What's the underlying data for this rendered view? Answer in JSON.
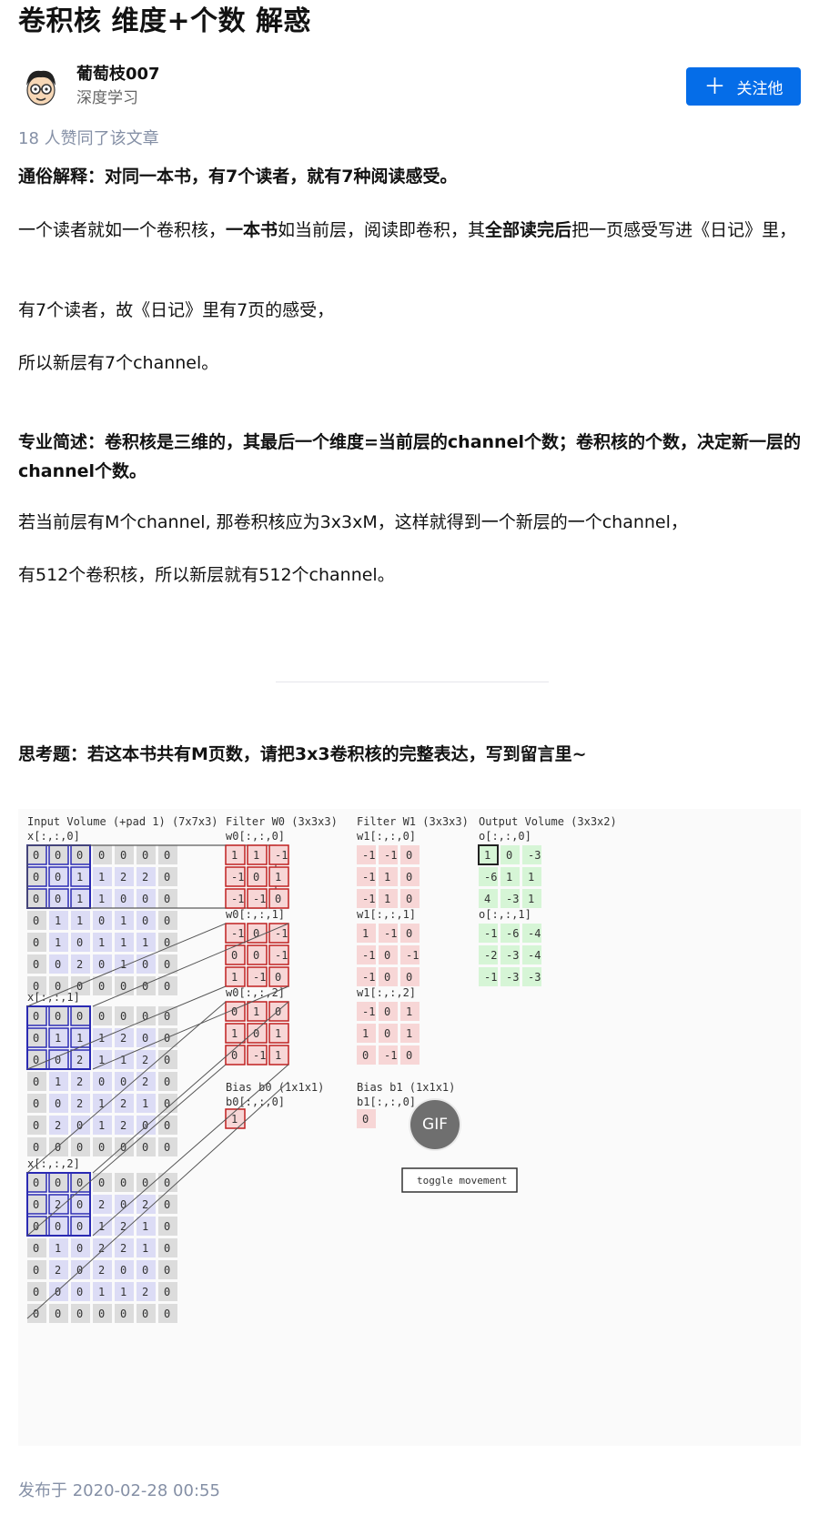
{
  "article": {
    "title": "卷积核 维度+个数 解惑",
    "author": {
      "name": "葡萄枝007",
      "headline": "深度学习",
      "follow_label": "关注他"
    },
    "votes_text": "18 人赞同了该文章",
    "para1": "通俗解释：对同一本书，有7个读者，就有7种阅读感受。",
    "para2": {
      "t1": "一个读者就如一个卷积核，",
      "b1": "一本书",
      "t2": "如当前层，阅读即卷积，其",
      "b2": "全部读完后",
      "t3": "把一页感受写进《日记》里，"
    },
    "para3": "有7个读者，故《日记》里有7页的感受，",
    "para4": "所以新层有7个channel。",
    "para5": "专业简述：卷积核是三维的，其最后一个维度=当前层的channel个数；卷积核的个数，决定新一层的channel个数。",
    "para6": "若当前层有M个channel, 那卷积核应为3x3xM，这样就得到一个新层的一个channel，",
    "para7": "有512个卷积核，所以新层就有512个channel。",
    "question": "思考题：若这本书共有M页数，请把3x3卷积核的完整表达，写到留言里~",
    "gif_badge": "GIF",
    "posted": "发布于 2020-02-28 00:55"
  },
  "figure": {
    "input_title": "Input Volume (+pad 1) (7x7x3)",
    "filter0_title": "Filter W0 (3x3x3)",
    "filter1_title": "Filter W1 (3x3x3)",
    "output_title": "Output Volume (3x3x2)",
    "x_labels": [
      "x[:,:,0]",
      "x[:,:,1]",
      "x[:,:,2]"
    ],
    "w0_labels": [
      "w0[:,:,0]",
      "w0[:,:,1]",
      "w0[:,:,2]"
    ],
    "w1_labels": [
      "w1[:,:,0]",
      "w1[:,:,1]",
      "w1[:,:,2]"
    ],
    "o_labels": [
      "o[:,:,0]",
      "o[:,:,1]"
    ],
    "bias0_title": "Bias b0 (1x1x1)",
    "bias0_label": "b0[:,:,0]",
    "bias1_title": "Bias b1 (1x1x1)",
    "bias1_label": "b1[:,:,0]",
    "toggle_label": "toggle movement",
    "x": [
      [
        [
          "0",
          "0",
          "0",
          "0",
          "0",
          "0",
          "0"
        ],
        [
          "0",
          "0",
          "1",
          "1",
          "2",
          "2",
          "0"
        ],
        [
          "0",
          "0",
          "1",
          "1",
          "0",
          "0",
          "0"
        ],
        [
          "0",
          "1",
          "1",
          "0",
          "1",
          "0",
          "0"
        ],
        [
          "0",
          "1",
          "0",
          "1",
          "1",
          "1",
          "0"
        ],
        [
          "0",
          "0",
          "2",
          "0",
          "1",
          "0",
          "0"
        ],
        [
          "0",
          "0",
          "0",
          "0",
          "0",
          "0",
          "0"
        ]
      ],
      [
        [
          "0",
          "0",
          "0",
          "0",
          "0",
          "0",
          "0"
        ],
        [
          "0",
          "1",
          "1",
          "1",
          "2",
          "0",
          "0"
        ],
        [
          "0",
          "0",
          "2",
          "1",
          "1",
          "2",
          "0"
        ],
        [
          "0",
          "1",
          "2",
          "0",
          "0",
          "2",
          "0"
        ],
        [
          "0",
          "0",
          "2",
          "1",
          "2",
          "1",
          "0"
        ],
        [
          "0",
          "2",
          "0",
          "1",
          "2",
          "0",
          "0"
        ],
        [
          "0",
          "0",
          "0",
          "0",
          "0",
          "0",
          "0"
        ]
      ],
      [
        [
          "0",
          "0",
          "0",
          "0",
          "0",
          "0",
          "0"
        ],
        [
          "0",
          "2",
          "0",
          "2",
          "0",
          "2",
          "0"
        ],
        [
          "0",
          "0",
          "0",
          "1",
          "2",
          "1",
          "0"
        ],
        [
          "0",
          "1",
          "0",
          "2",
          "2",
          "1",
          "0"
        ],
        [
          "0",
          "2",
          "0",
          "2",
          "0",
          "0",
          "0"
        ],
        [
          "0",
          "0",
          "0",
          "1",
          "1",
          "2",
          "0"
        ],
        [
          "0",
          "0",
          "0",
          "0",
          "0",
          "0",
          "0"
        ]
      ]
    ],
    "w0": [
      [
        [
          "1",
          "1",
          "-1"
        ],
        [
          "-1",
          "0",
          "1"
        ],
        [
          "-1",
          "-1",
          "0"
        ]
      ],
      [
        [
          "-1",
          "0",
          "-1"
        ],
        [
          "0",
          "0",
          "-1"
        ],
        [
          "1",
          "-1",
          "0"
        ]
      ],
      [
        [
          "0",
          "1",
          "0"
        ],
        [
          "1",
          "0",
          "1"
        ],
        [
          "0",
          "-1",
          "1"
        ]
      ]
    ],
    "w1": [
      [
        [
          "-1",
          "-1",
          "0"
        ],
        [
          "-1",
          "1",
          "0"
        ],
        [
          "-1",
          "1",
          "0"
        ]
      ],
      [
        [
          "1",
          "-1",
          "0"
        ],
        [
          "-1",
          "0",
          "-1"
        ],
        [
          "-1",
          "0",
          "0"
        ]
      ],
      [
        [
          "-1",
          "0",
          "1"
        ],
        [
          "1",
          "0",
          "1"
        ],
        [
          "0",
          "-1",
          "0"
        ]
      ]
    ],
    "b0": "1",
    "b1": "0",
    "o": [
      [
        [
          "1",
          "0",
          "-3"
        ],
        [
          "-6",
          "1",
          "1"
        ],
        [
          "4",
          "-3",
          "1"
        ]
      ],
      [
        [
          "-1",
          "-6",
          "-4"
        ],
        [
          "-2",
          "-3",
          "-4"
        ],
        [
          "-1",
          "-3",
          "-3"
        ]
      ]
    ]
  },
  "colors": {
    "accent": "#056de8",
    "muted": "#8590a6",
    "input_cell": "#dcdcf5",
    "pad_cell": "#dcdcdc",
    "filter_cell": "#f7d6d6",
    "output_cell": "#d6f5d6"
  }
}
